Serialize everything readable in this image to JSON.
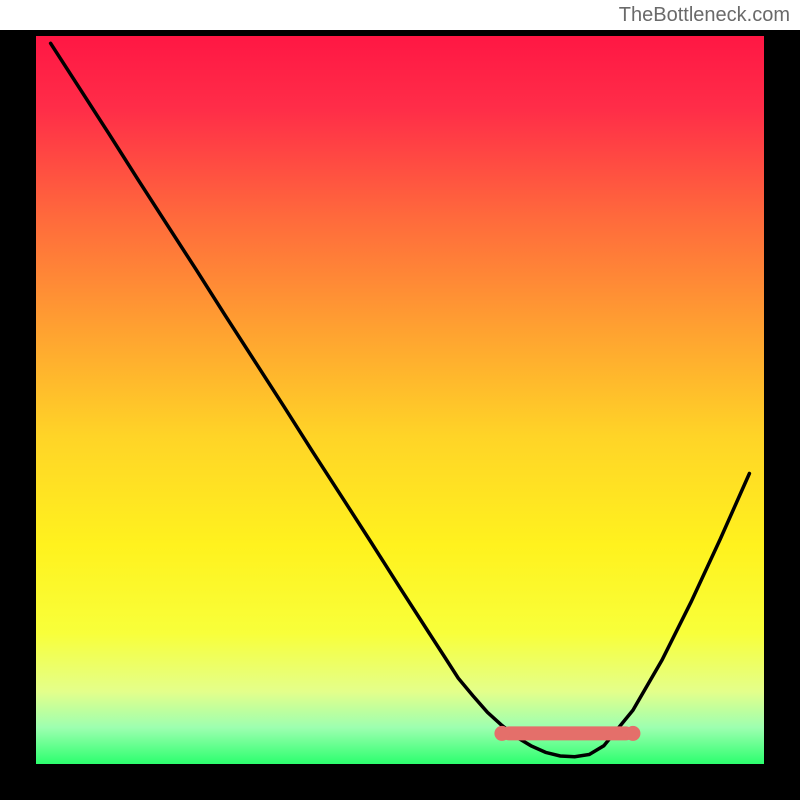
{
  "watermark": "TheBottleneck.com",
  "chart_data": {
    "type": "line",
    "title": "",
    "xlabel": "",
    "ylabel": "",
    "xlim": [
      0,
      100
    ],
    "ylim": [
      0,
      100
    ],
    "x": [
      2,
      6,
      10,
      14,
      18,
      22,
      26,
      30,
      34,
      38,
      42,
      46,
      50,
      54,
      56,
      58,
      60,
      62,
      64,
      66,
      68,
      70,
      72,
      74,
      76,
      78,
      82,
      86,
      90,
      94,
      98
    ],
    "values": [
      99,
      92.8,
      86.6,
      80.3,
      74.1,
      67.9,
      61.6,
      55.4,
      49.2,
      42.9,
      36.7,
      30.5,
      24.2,
      18.0,
      14.9,
      11.8,
      9.4,
      7.1,
      5.3,
      3.7,
      2.5,
      1.6,
      1.1,
      1.0,
      1.3,
      2.5,
      7.4,
      14.3,
      22.3,
      30.9,
      39.9
    ],
    "highlight_band": {
      "x_start": 64,
      "x_end": 82,
      "y": 4.2
    },
    "gradient_stops": [
      {
        "offset": 0.0,
        "color": "#ff1744"
      },
      {
        "offset": 0.1,
        "color": "#ff2d48"
      },
      {
        "offset": 0.25,
        "color": "#ff6a3c"
      },
      {
        "offset": 0.4,
        "color": "#ffa031"
      },
      {
        "offset": 0.55,
        "color": "#ffd427"
      },
      {
        "offset": 0.7,
        "color": "#fff21e"
      },
      {
        "offset": 0.82,
        "color": "#f8ff3a"
      },
      {
        "offset": 0.9,
        "color": "#e4ff8a"
      },
      {
        "offset": 0.95,
        "color": "#9dffb0"
      },
      {
        "offset": 1.0,
        "color": "#2cff6e"
      }
    ],
    "frame_color": "#000000",
    "curve_color": "#000000",
    "highlight_color": "#e46f6a"
  },
  "geometry": {
    "outer": 800,
    "top_margin": 30,
    "plot_inner_left": 36,
    "plot_inner_top": 30,
    "plot_inner_size": 728,
    "frame_thickness": 36
  }
}
